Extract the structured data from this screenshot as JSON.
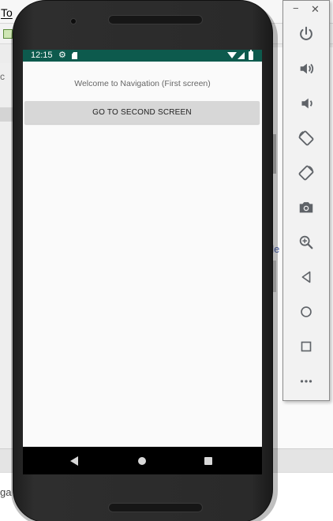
{
  "ide": {
    "menu_fragment": "To",
    "left_fragment": "c",
    "right_link_fragment_1": "ole",
    "right_link_fragment_2": "e",
    "bottom_fragment": "ga"
  },
  "phone": {
    "status_bar": {
      "time": "12:15",
      "bg_color": "#0d5a4d"
    },
    "screen": {
      "welcome_text": "Welcome to Navigation (First screen)",
      "button_label": "GO TO SECOND SCREEN"
    },
    "nav_bar": {
      "back_icon": "back-triangle-icon",
      "home_icon": "home-circle-icon",
      "recents_icon": "recents-square-icon"
    }
  },
  "emulator_toolbar": {
    "minimize_label": "−",
    "close_label": "✕",
    "buttons": [
      {
        "name": "power",
        "icon": "power-icon"
      },
      {
        "name": "volume-up",
        "icon": "volume-up-icon"
      },
      {
        "name": "volume-down",
        "icon": "volume-down-icon"
      },
      {
        "name": "rotate-left",
        "icon": "rotate-left-icon"
      },
      {
        "name": "rotate-right",
        "icon": "rotate-right-icon"
      },
      {
        "name": "screenshot",
        "icon": "camera-icon"
      },
      {
        "name": "zoom",
        "icon": "zoom-in-icon"
      },
      {
        "name": "back",
        "icon": "back-icon"
      },
      {
        "name": "home",
        "icon": "home-icon"
      },
      {
        "name": "overview",
        "icon": "overview-icon"
      },
      {
        "name": "more",
        "icon": "more-icon"
      }
    ]
  }
}
